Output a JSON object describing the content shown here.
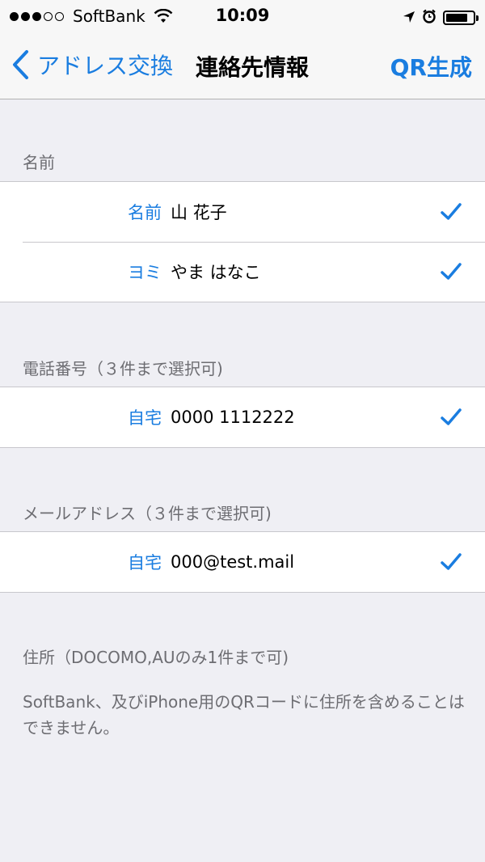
{
  "status_bar": {
    "carrier": "SoftBank",
    "time": "10:09",
    "signal_dots_filled": 3,
    "signal_dots_total": 5,
    "battery_level": 0.8
  },
  "nav": {
    "back_label": "アドレス交換",
    "title": "連絡先情報",
    "action_label": "QR生成"
  },
  "accent_color": "#1a7de0",
  "sections": {
    "name": {
      "header": "名前",
      "rows": [
        {
          "label": "名前",
          "value": "山 花子",
          "checked": true
        },
        {
          "label": "ヨミ",
          "value": "やま はなこ",
          "checked": true
        }
      ]
    },
    "phone": {
      "header": "電話番号（３件まで選択可)",
      "rows": [
        {
          "label": "自宅",
          "value": "0000 1112222",
          "checked": true
        }
      ]
    },
    "email": {
      "header": "メールアドレス（３件まで選択可)",
      "rows": [
        {
          "label": "自宅",
          "value": "000@test.mail",
          "checked": true
        }
      ]
    },
    "address": {
      "header": "住所（DOCOMO,AUのみ1件まで可)",
      "note": "SoftBank、及びiPhone用のQRコードに住所を含めることはできません。"
    }
  }
}
